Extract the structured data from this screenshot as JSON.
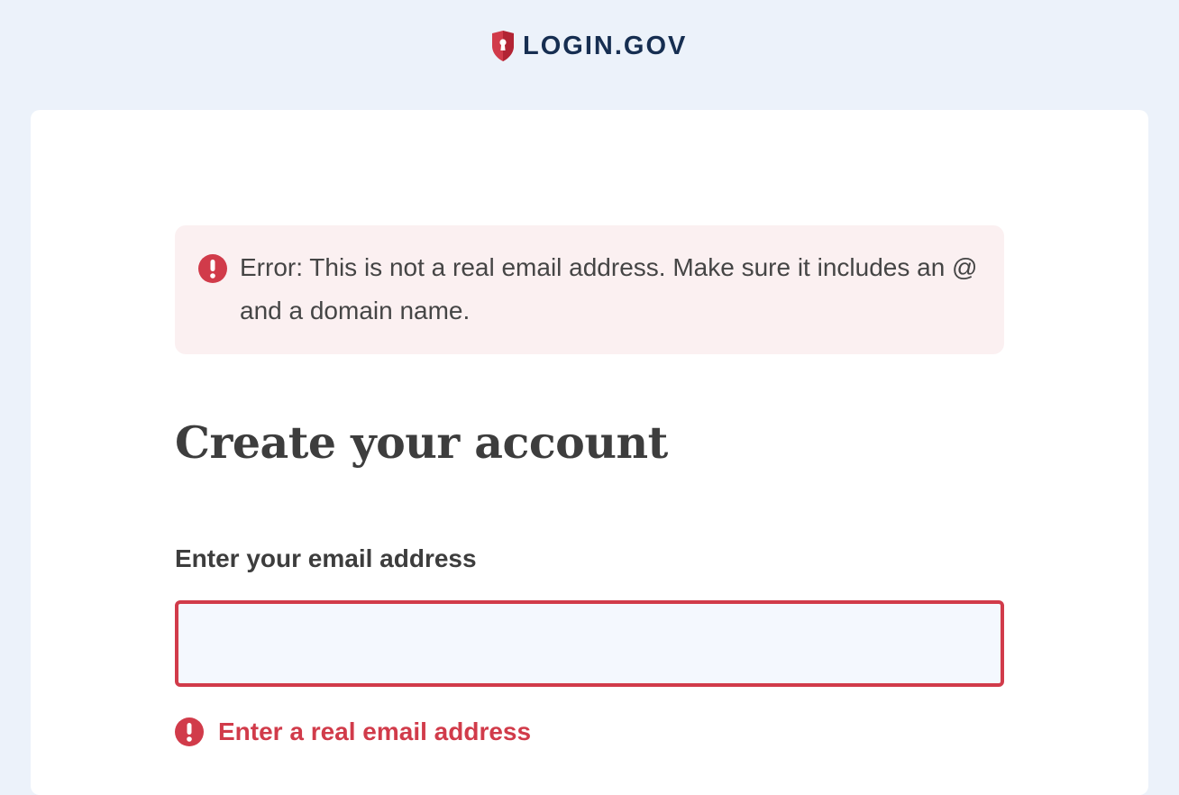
{
  "header": {
    "brand": "LOGIN.GOV"
  },
  "alert": {
    "message": "Error: This is not a real email address. Make sure it includes an @ and a domain name."
  },
  "form": {
    "title": "Create your account",
    "email_label": "Enter your email address",
    "email_value": "",
    "email_placeholder": "",
    "error_message": "Enter a real email address"
  },
  "colors": {
    "background": "#ecf2fa",
    "brand_navy": "#162e51",
    "error_red": "#d13b4a",
    "alert_bg": "#fbf0f1",
    "input_bg": "#f4f8fe"
  },
  "icons": {
    "brand_logo": "shield-keyhole-icon",
    "alert_icon": "exclamation-circle-icon",
    "field_error_icon": "exclamation-circle-icon"
  }
}
